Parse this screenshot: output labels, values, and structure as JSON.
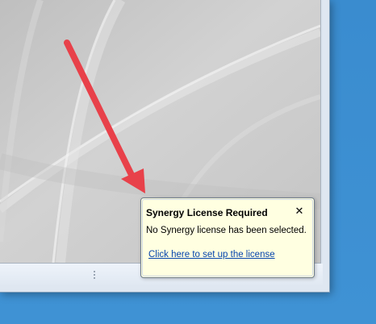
{
  "notification": {
    "title": "Synergy License Required",
    "close_glyph": "✕",
    "message": "No Synergy license has been selected.",
    "link_text": "Click here to set up the license"
  },
  "annotation": {
    "arrow_color": "#e8414a"
  },
  "colors": {
    "balloon_background": "#ffffe1",
    "link": "#0645ad",
    "desktop": "#3d8fd1"
  },
  "icons": {
    "close": "close-icon",
    "status_grip": "resize-grip-icon",
    "arrow": "red-arrow-annotation"
  }
}
